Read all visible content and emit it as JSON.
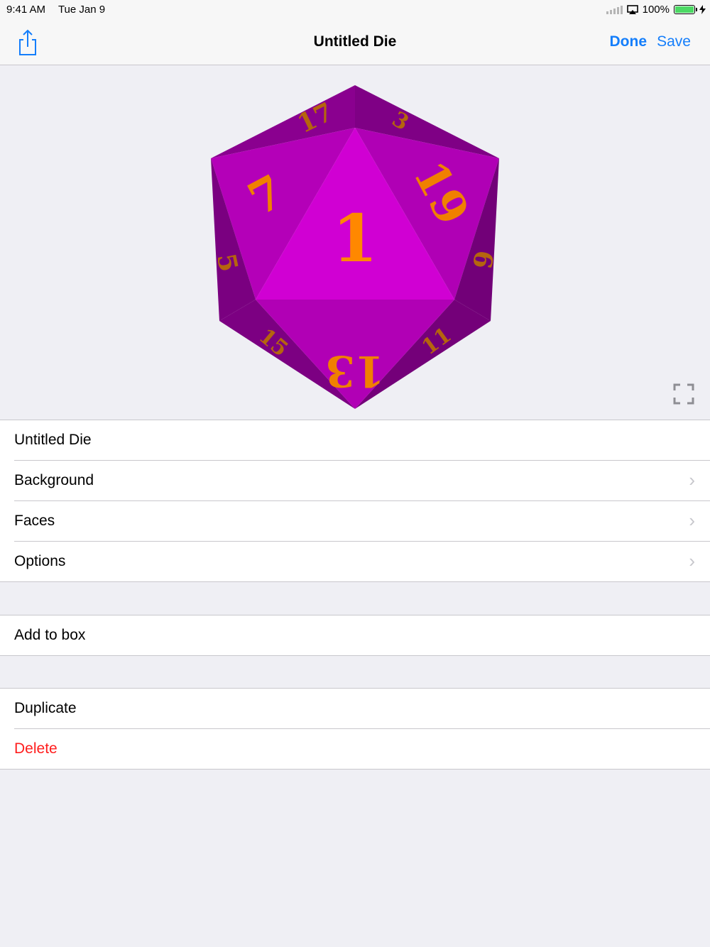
{
  "status_bar": {
    "time": "9:41 AM",
    "date": "Tue Jan 9",
    "battery_text": "100%",
    "battery_color": "#4cd964"
  },
  "nav": {
    "title": "Untitled Die",
    "done_label": "Done",
    "save_label": "Save",
    "share_icon": "share-icon",
    "accent": "#147efb"
  },
  "die": {
    "face_numbers": {
      "center": "1",
      "upper_left": "7",
      "upper_right": "19",
      "bottom": "13",
      "top_left": "17",
      "top_right": "3",
      "left_side": "5",
      "right_side": "9",
      "bottom_left": "15",
      "bottom_right": "11"
    },
    "colors": {
      "face": "#d000d3",
      "face_dark": "#7a0080",
      "number": "#ff8800"
    }
  },
  "settings": {
    "name_value": "Untitled Die",
    "background_label": "Background",
    "faces_label": "Faces",
    "options_label": "Options",
    "add_to_box_label": "Add to box",
    "duplicate_label": "Duplicate",
    "delete_label": "Delete"
  }
}
